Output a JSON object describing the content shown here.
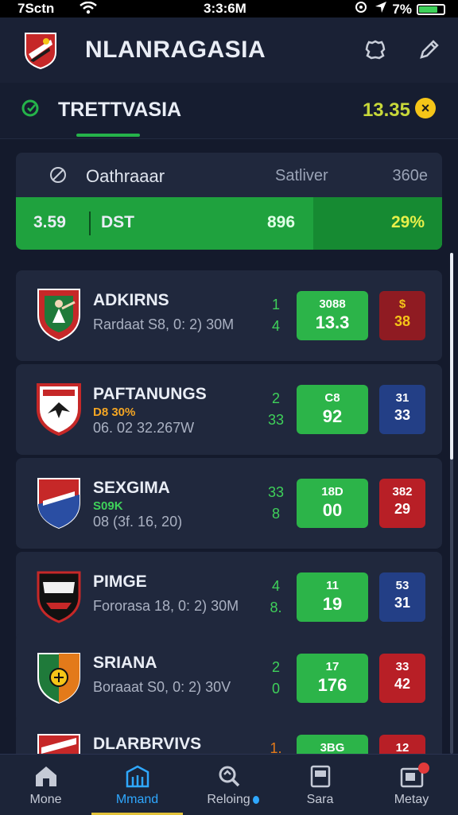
{
  "status_bar": {
    "carrier": "7Sctn",
    "time": "3:3:6M",
    "battery": "7%"
  },
  "header": {
    "title": "NLANRAGASIA"
  },
  "subheader": {
    "title": "TRETTVASIA",
    "value": "13.35"
  },
  "summary": {
    "name": "Oathraaar",
    "col1": "Satliver",
    "col2": "360e",
    "bar_values": [
      "3.59",
      "DST",
      "896",
      "29%"
    ]
  },
  "matches": [
    {
      "team": "ADKIRNS",
      "tag": "",
      "detail": "Rardaat S8, 0: 2) 30M",
      "score1": "1",
      "score2": "4",
      "odds_main_top": "3088",
      "odds_main_bottom": "13.3",
      "odds_side_top": "$",
      "odds_side_bottom": "38",
      "side_color": "#8f1b22",
      "side_text_color": "#f5c518",
      "tag_color": ""
    },
    {
      "team": "PAFTANUNGS",
      "tag": "D8 30%",
      "detail": "06. 02 32.267W",
      "score1": "2",
      "score2": "33",
      "odds_main_top": "C8",
      "odds_main_bottom": "92",
      "odds_side_top": "31",
      "odds_side_bottom": "33",
      "side_color": "#233f86",
      "side_text_color": "#ffffff",
      "tag_color": "#f5a623"
    },
    {
      "team": "SEXGIMA",
      "tag": "S09K",
      "detail": "08 (3f. 16, 20)",
      "score1": "33",
      "score2": "8",
      "odds_main_top": "18D",
      "odds_main_bottom": "00",
      "odds_side_top": "382",
      "odds_side_bottom": "29",
      "side_color": "#b81f26",
      "side_text_color": "#ffffff",
      "tag_color": "#3fd15a"
    },
    {
      "team": "PIMGE",
      "tag": "",
      "detail": "Fororasa 18, 0: 2) 30M",
      "score1": "4",
      "score2": "8.",
      "odds_main_top": "11",
      "odds_main_bottom": "19",
      "odds_side_top": "53",
      "odds_side_bottom": "31",
      "side_color": "#233f86",
      "side_text_color": "#ffffff",
      "tag_color": ""
    },
    {
      "team": "SRIANA",
      "tag": "",
      "detail": "Boraaat S0, 0: 2) 30V",
      "score1": "2",
      "score2": "0",
      "odds_main_top": "17",
      "odds_main_bottom": "176",
      "odds_side_top": "33",
      "odds_side_bottom": "42",
      "side_color": "#b81f26",
      "side_text_color": "#ffffff",
      "tag_color": ""
    },
    {
      "team": "DLARBRVIVS",
      "tag": "",
      "detail": "",
      "score1": "1.",
      "score2": "",
      "odds_main_top": "",
      "odds_main_bottom": "3BG",
      "odds_side_top": "",
      "odds_side_bottom": "12",
      "side_color": "#b81f26",
      "side_text_color": "#ffffff",
      "tag_color": ""
    }
  ],
  "tabs": [
    {
      "label": "Mone",
      "icon": "home-icon"
    },
    {
      "label": "Mmand",
      "icon": "stadium-icon"
    },
    {
      "label": "Reloing",
      "icon": "refresh-search-icon"
    },
    {
      "label": "Sara",
      "icon": "card-icon"
    },
    {
      "label": "Metay",
      "icon": "wallet-icon"
    }
  ],
  "colors": {
    "background": "#141a2c",
    "card": "#20283d",
    "green": "#2cb449",
    "accent_blue": "#2fa8ff",
    "accent_yellow": "#f5c518"
  }
}
